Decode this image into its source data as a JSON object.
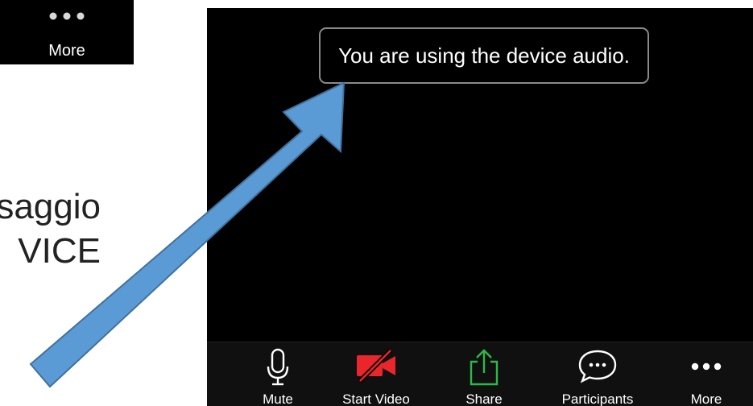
{
  "top_left_tile": {
    "label": "More",
    "icon": "more-dots-icon"
  },
  "slide_caption": {
    "line1": "saggio",
    "line2": "VICE"
  },
  "toast": {
    "message": "You are using the device audio."
  },
  "toolbar": {
    "mute": {
      "label": "Mute",
      "icon": "microphone-icon"
    },
    "start_video": {
      "label": "Start Video",
      "icon": "video-off-icon",
      "color": "#e8262b"
    },
    "share": {
      "label": "Share",
      "icon": "share-icon",
      "color": "#2fb84a"
    },
    "participants": {
      "label": "Participants",
      "icon": "chat-bubble-icon"
    },
    "more": {
      "label": "More",
      "icon": "more-dots-icon"
    }
  },
  "annotation_arrow": {
    "color": "#5b9bd5",
    "icon": "pointer-arrow"
  }
}
